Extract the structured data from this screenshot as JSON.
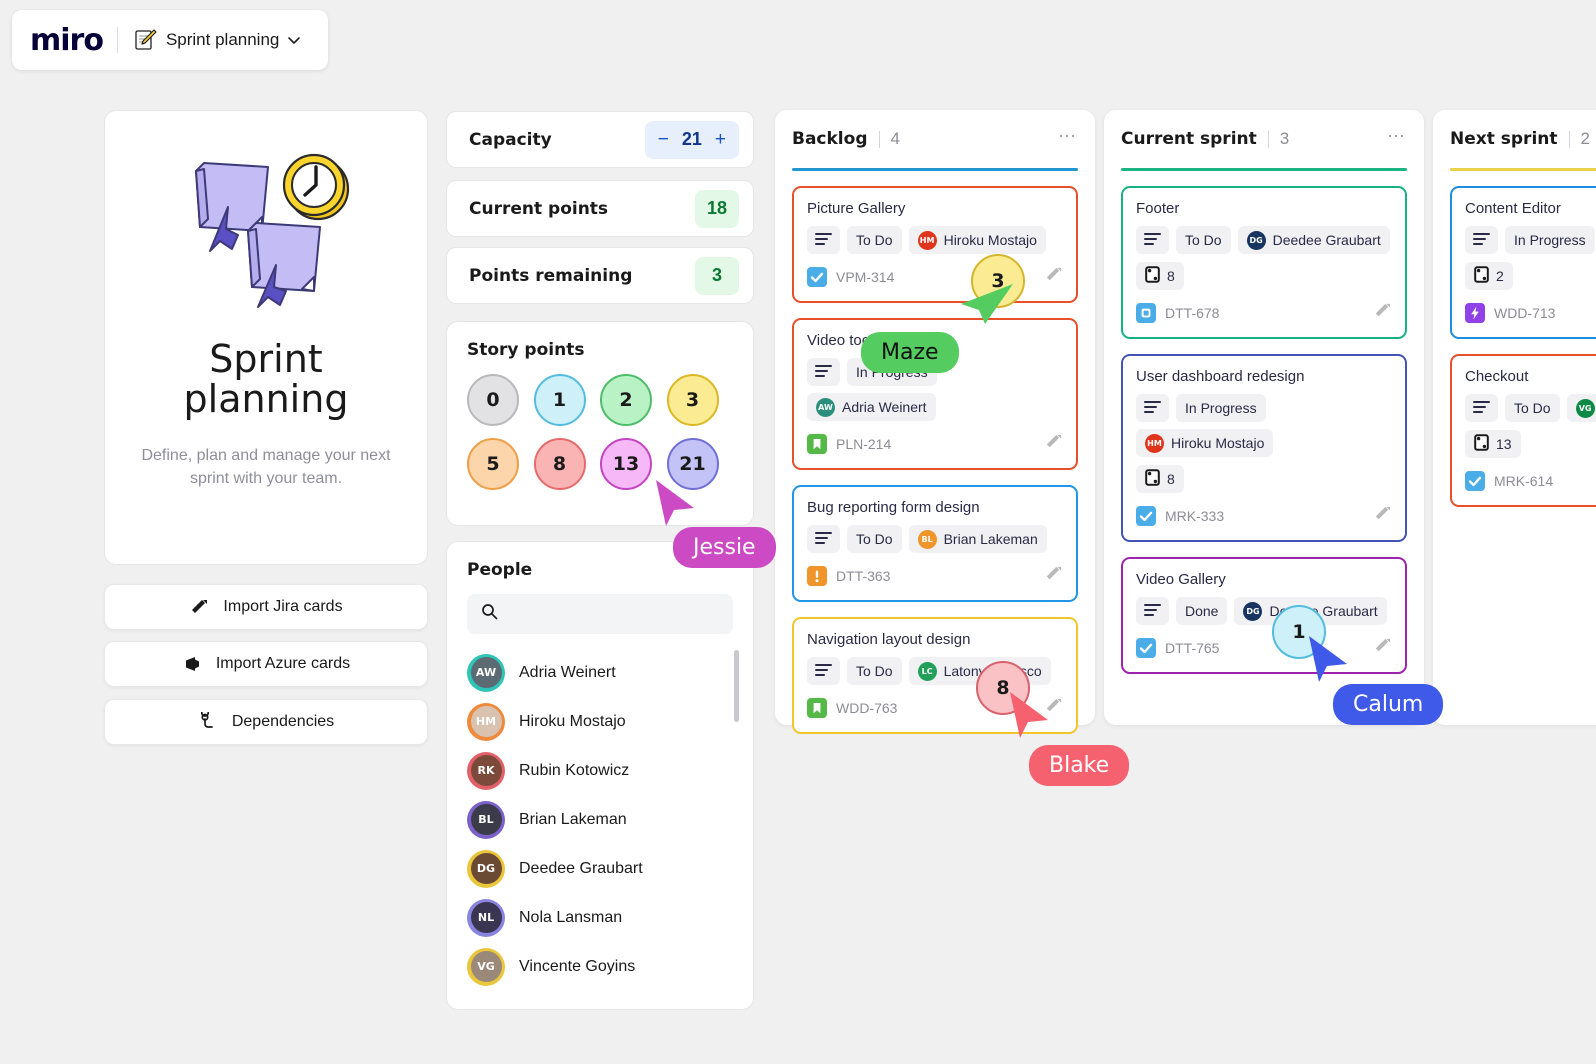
{
  "topbar": {
    "logo": "miro",
    "board_title": "Sprint planning",
    "memo_icon": "memo-pencil-icon",
    "chevron_icon": "chevron-down-icon"
  },
  "intro": {
    "title_line1": "Sprint",
    "title_line2": "planning",
    "subtitle": "Define, plan and manage your next sprint with your team.",
    "buttons": [
      {
        "label": "Import Jira cards",
        "icon": "jira-icon"
      },
      {
        "label": "Import Azure cards",
        "icon": "azure-devops-icon"
      },
      {
        "label": "Dependencies",
        "icon": "dependency-link-icon"
      }
    ]
  },
  "stats": {
    "capacity": {
      "label": "Capacity",
      "value": "21",
      "minus": "−",
      "plus": "+"
    },
    "current_points": {
      "label": "Current points",
      "value": "18"
    },
    "points_remaining": {
      "label": "Points remaining",
      "value": "3"
    }
  },
  "story_points": {
    "title": "Story points",
    "chips": [
      {
        "value": "0",
        "fill": "#e2e2e4",
        "border": "#b8b8bd"
      },
      {
        "value": "1",
        "fill": "#cdf0f9",
        "border": "#53bde0"
      },
      {
        "value": "2",
        "fill": "#b9f2c4",
        "border": "#4dbd6a"
      },
      {
        "value": "3",
        "fill": "#fbeb92",
        "border": "#dcb827"
      },
      {
        "value": "5",
        "fill": "#fcd5ab",
        "border": "#ee9f47"
      },
      {
        "value": "8",
        "fill": "#fbb4b4",
        "border": "#e76a6a"
      },
      {
        "value": "13",
        "fill": "#f6b8f6",
        "border": "#c445c4"
      },
      {
        "value": "21",
        "fill": "#c3c3f7",
        "border": "#6f6fd8"
      }
    ]
  },
  "people": {
    "title": "People",
    "search_placeholder": "",
    "search_value": "",
    "search_icon": "search-icon",
    "items": [
      {
        "name": "Adria Weinert",
        "initials": "AW",
        "ring": "#2ec4b6",
        "fill": "#5c6b73"
      },
      {
        "name": "Hiroku Mostajo",
        "initials": "HM",
        "ring": "#ef8a3c",
        "fill": "#d9c2b0"
      },
      {
        "name": "Rubin Kotowicz",
        "initials": "RK",
        "ring": "#e2606a",
        "fill": "#7b4a3a"
      },
      {
        "name": "Brian Lakeman",
        "initials": "BL",
        "ring": "#7b61c9",
        "fill": "#3c3b4a"
      },
      {
        "name": "Deedee Graubart",
        "initials": "DG",
        "ring": "#e9c63c",
        "fill": "#6b4a33"
      },
      {
        "name": "Nola Lansman",
        "initials": "NL",
        "ring": "#8884e0",
        "fill": "#3a3550"
      },
      {
        "name": "Vincente Goyins",
        "initials": "VG",
        "ring": "#e9c63c",
        "fill": "#9a8878"
      }
    ]
  },
  "columns": [
    {
      "name": "Backlog",
      "count": "4",
      "rule_color": "#2196cf",
      "menu_icon": "more-options-icon",
      "cards": [
        {
          "title": "Picture Gallery",
          "border": "#e8502a",
          "status": "To Do",
          "assignee": "Hiroku Mostajo",
          "assignee_initials": "HM",
          "assignee_color": "#e0351d",
          "points": "",
          "key": "VPM-314",
          "key_icon": "task-check-icon",
          "key_icon_color": "#4bade8",
          "desc_icon": "description-lines-icon",
          "jira_icon": "jira-icon"
        },
        {
          "title": "Video tooltips",
          "border": "#e8502a",
          "status": "In Progress",
          "assignee": "Adria Weinert",
          "assignee_initials": "AW",
          "assignee_color": "#2a8f7d",
          "points": "",
          "key": "PLN-214",
          "key_icon": "story-bookmark-icon",
          "key_icon_color": "#55b948",
          "desc_icon": "description-lines-icon",
          "jira_icon": "jira-icon"
        },
        {
          "title": "Bug reporting form design",
          "border": "#2196e8",
          "status": "To Do",
          "assignee": "Brian Lakeman",
          "assignee_initials": "BL",
          "assignee_color": "#f0952a",
          "points": "",
          "key": "DTT-363",
          "key_icon": "bug-alert-icon",
          "key_icon_color": "#f0952a",
          "desc_icon": "description-lines-icon",
          "jira_icon": "jira-icon"
        },
        {
          "title": "Navigation layout design",
          "border": "#f2c629",
          "status": "To Do",
          "assignee": "Latonya Crusco",
          "assignee_initials": "LC",
          "assignee_color": "#22a05a",
          "points": "",
          "key": "WDD-763",
          "key_icon": "story-bookmark-icon",
          "key_icon_color": "#55b948",
          "desc_icon": "description-lines-icon",
          "jira_icon": "jira-icon"
        }
      ]
    },
    {
      "name": "Current sprint",
      "count": "3",
      "rule_color": "#1bb583",
      "menu_icon": "more-options-icon",
      "cards": [
        {
          "title": "Footer",
          "border": "#17b184",
          "status": "To Do",
          "assignee": "Deedee Graubart",
          "assignee_initials": "DG",
          "assignee_color": "#17355f",
          "points": "8",
          "key": "DTT-678",
          "key_icon": "task-card-icon",
          "key_icon_color": "#4bade8",
          "desc_icon": "description-lines-icon",
          "jira_icon": "jira-icon"
        },
        {
          "title": "User dashboard redesign",
          "border": "#4552b8",
          "status": "In Progress",
          "assignee": "Hiroku Mostajo",
          "assignee_initials": "HM",
          "assignee_color": "#e0351d",
          "points": "8",
          "key": "MRK-333",
          "key_icon": "task-check-icon",
          "key_icon_color": "#4bade8",
          "desc_icon": "description-lines-icon",
          "jira_icon": "jira-icon"
        },
        {
          "title": "Video Gallery",
          "border": "#9c23ab",
          "status": "Done",
          "assignee": "Deedee Graubart",
          "assignee_initials": "DG",
          "assignee_color": "#17355f",
          "points": "",
          "key": "DTT-765",
          "key_icon": "task-check-icon",
          "key_icon_color": "#4bade8",
          "desc_icon": "description-lines-icon",
          "jira_icon": "jira-icon"
        }
      ]
    },
    {
      "name": "Next sprint",
      "count": "2",
      "rule_color": "#e8d24a",
      "menu_icon": "more-options-icon",
      "cards": [
        {
          "title": "Content Editor",
          "border": "#1f8ddd",
          "status": "In Progress",
          "assignee": "",
          "assignee_initials": "",
          "assignee_color": "#888",
          "points": "2",
          "key": "WDD-713",
          "key_icon": "epic-bolt-icon",
          "key_icon_color": "#9141e8",
          "desc_icon": "description-lines-icon",
          "jira_icon": "jira-icon"
        },
        {
          "title": "Checkout",
          "border": "#e8502a",
          "status": "To Do",
          "assignee": "",
          "assignee_initials": "VG",
          "assignee_color": "#0f8a46",
          "points": "13",
          "key": "MRK-614",
          "key_icon": "task-check-icon",
          "key_icon_color": "#4bade8",
          "desc_icon": "description-lines-icon",
          "jira_icon": "jira-icon"
        }
      ]
    }
  ],
  "collaborators": [
    {
      "name": "Maze",
      "label_bg": "#55cc5f",
      "label_text_color": "#111111",
      "cursor_color": "#55cc5f",
      "point_value": "3",
      "point_fill": "#fbeb92",
      "point_border": "#d4b52b"
    },
    {
      "name": "Jessie",
      "label_bg": "#cc4bc4",
      "label_text_color": "#ffffff",
      "cursor_color": "#cc4bc4",
      "point_value": "",
      "point_fill": "",
      "point_border": ""
    },
    {
      "name": "Blake",
      "label_bg": "#f6616f",
      "label_text_color": "#ffffff",
      "cursor_color": "#f6616f",
      "point_value": "8",
      "point_fill": "#fbc2c6",
      "point_border": "#d9606c"
    },
    {
      "name": "Calum",
      "label_bg": "#3f5ae8",
      "label_text_color": "#ffffff",
      "cursor_color": "#3f5ae8",
      "point_value": "1",
      "point_fill": "#cdf0f9",
      "point_border": "#53bde0"
    }
  ]
}
